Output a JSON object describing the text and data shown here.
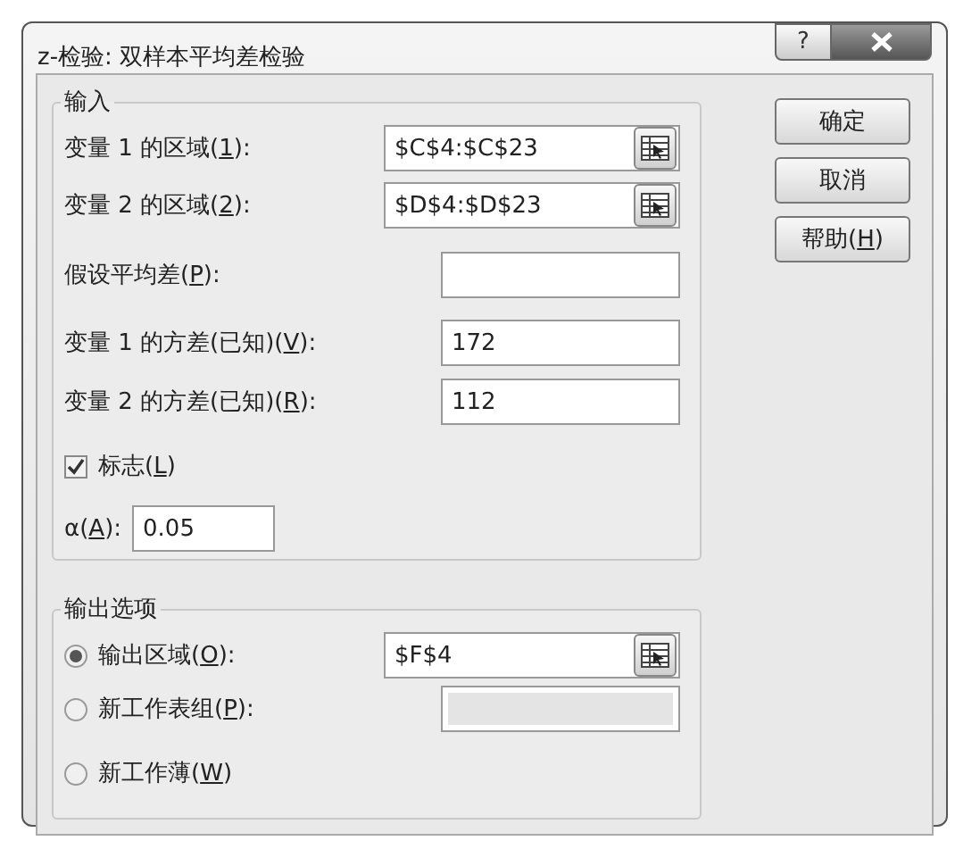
{
  "window": {
    "title": "z-检验: 双样本平均差检验",
    "help_label": "?"
  },
  "input_group": {
    "legend": "输入",
    "rows": [
      {
        "kind": "range",
        "label": {
          "before": "变量 1 的区域(",
          "key": "1",
          "after": "):"
        },
        "value": "$C$4:$C$23"
      },
      {
        "kind": "range",
        "label": {
          "before": "变量 2 的区域(",
          "key": "2",
          "after": "):"
        },
        "value": "$D$4:$D$23"
      },
      {
        "kind": "number",
        "label": {
          "before": "假设平均差(",
          "key": "P",
          "after": "):"
        }
      },
      {
        "kind": "number",
        "label": {
          "before": "变量 1 的方差(已知)(",
          "key": "V",
          "after": "):"
        },
        "value": "172"
      },
      {
        "kind": "number",
        "label": {
          "before": "变量 2 的方差(已知)(",
          "key": "R",
          "after": "):"
        },
        "value": "112"
      },
      {
        "kind": "checkbox",
        "label": {
          "before": "标志(",
          "key": "L",
          "after": ")"
        },
        "checked": true
      },
      {
        "kind": "alpha",
        "label": {
          "before": "α(",
          "key": "A",
          "after": "):"
        },
        "value": "0.05"
      }
    ]
  },
  "output_group": {
    "legend": "输出选项",
    "options": [
      {
        "label": {
          "before": "输出区域(",
          "key": "O",
          "after": "):"
        },
        "selected": true,
        "field": {
          "kind": "range",
          "value": "$F$4",
          "disabled": false
        }
      },
      {
        "label": {
          "before": "新工作表组(",
          "key": "P",
          "after": "):"
        },
        "selected": false,
        "field": {
          "kind": "text",
          "disabled": true
        }
      },
      {
        "label": {
          "before": "新工作薄(",
          "key": "W",
          "after": ")"
        },
        "selected": false
      }
    ]
  },
  "buttons": [
    {
      "label": {
        "before": "确定"
      }
    },
    {
      "label": {
        "before": "取消"
      }
    },
    {
      "label": {
        "before": "帮助(",
        "key": "H",
        "after": ")"
      }
    }
  ]
}
